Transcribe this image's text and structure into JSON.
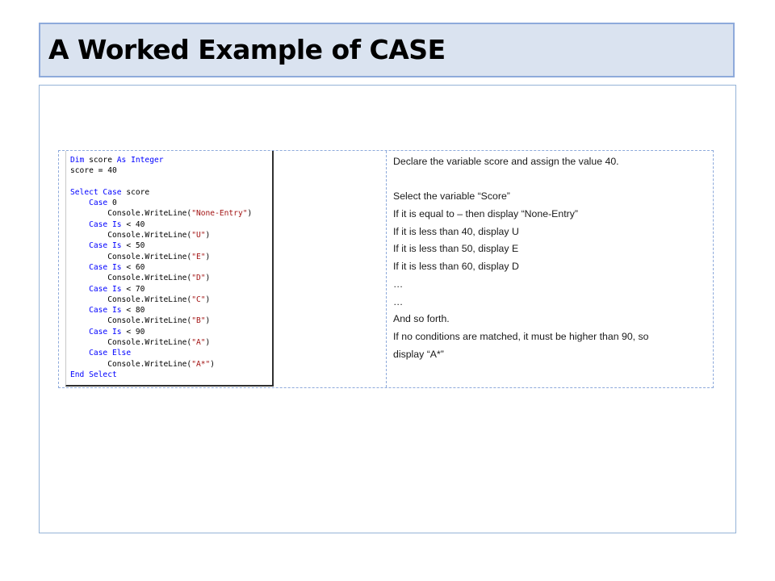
{
  "slide": {
    "title": "A Worked Example of CASE"
  },
  "code": {
    "lines": [
      [
        {
          "t": "Dim ",
          "k": true
        },
        {
          "t": "score "
        },
        {
          "t": "As Integer",
          "k": true
        }
      ],
      [
        {
          "t": "score = 40"
        }
      ],
      [
        {
          "t": ""
        }
      ],
      [
        {
          "t": "Select Case ",
          "k": true
        },
        {
          "t": "score"
        }
      ],
      [
        {
          "t": "    "
        },
        {
          "t": "Case ",
          "k": true
        },
        {
          "t": "0"
        }
      ],
      [
        {
          "t": "        Console.WriteLine("
        },
        {
          "t": "\"None-Entry\"",
          "s": true
        },
        {
          "t": ")"
        }
      ],
      [
        {
          "t": "    "
        },
        {
          "t": "Case Is ",
          "k": true
        },
        {
          "t": "< 40"
        }
      ],
      [
        {
          "t": "        Console.WriteLine("
        },
        {
          "t": "\"U\"",
          "s": true
        },
        {
          "t": ")"
        }
      ],
      [
        {
          "t": "    "
        },
        {
          "t": "Case Is ",
          "k": true
        },
        {
          "t": "< 50"
        }
      ],
      [
        {
          "t": "        Console.WriteLine("
        },
        {
          "t": "\"E\"",
          "s": true
        },
        {
          "t": ")"
        }
      ],
      [
        {
          "t": "    "
        },
        {
          "t": "Case Is ",
          "k": true
        },
        {
          "t": "< 60"
        }
      ],
      [
        {
          "t": "        Console.WriteLine("
        },
        {
          "t": "\"D\"",
          "s": true
        },
        {
          "t": ")"
        }
      ],
      [
        {
          "t": "    "
        },
        {
          "t": "Case Is ",
          "k": true
        },
        {
          "t": "< 70"
        }
      ],
      [
        {
          "t": "        Console.WriteLine("
        },
        {
          "t": "\"C\"",
          "s": true
        },
        {
          "t": ")"
        }
      ],
      [
        {
          "t": "    "
        },
        {
          "t": "Case Is ",
          "k": true
        },
        {
          "t": "< 80"
        }
      ],
      [
        {
          "t": "        Console.WriteLine("
        },
        {
          "t": "\"B\"",
          "s": true
        },
        {
          "t": ")"
        }
      ],
      [
        {
          "t": "    "
        },
        {
          "t": "Case Is ",
          "k": true
        },
        {
          "t": "< 90"
        }
      ],
      [
        {
          "t": "        Console.WriteLine("
        },
        {
          "t": "\"A\"",
          "s": true
        },
        {
          "t": ")"
        }
      ],
      [
        {
          "t": "    "
        },
        {
          "t": "Case Else",
          "k": true
        }
      ],
      [
        {
          "t": "        Console.WriteLine("
        },
        {
          "t": "\"A*\"",
          "s": true
        },
        {
          "t": ")"
        }
      ],
      [
        {
          "t": "End Select",
          "k": true
        }
      ]
    ]
  },
  "notes": {
    "lines": [
      "Declare the variable score and assign the value 40.",
      "",
      "Select the variable “Score”",
      "If it is equal to – then display “None-Entry”",
      "If it is less than 40, display U",
      "If it is less than 50, display E",
      "If it is less than 60, display D",
      "…",
      "…",
      "And so forth.",
      "If no conditions are matched, it must be higher than 90, so",
      "display “A*”"
    ]
  }
}
